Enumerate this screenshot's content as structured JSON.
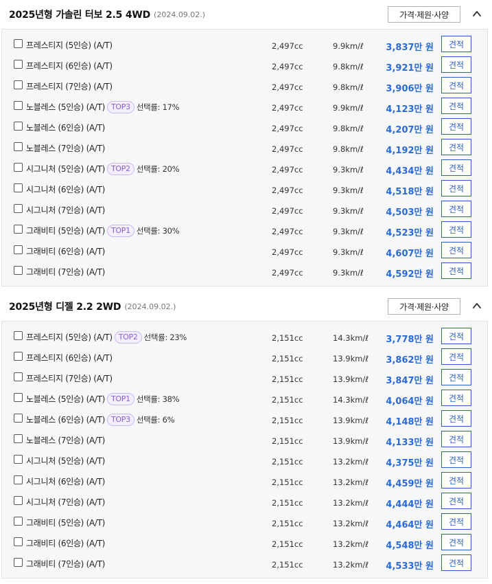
{
  "sections": [
    {
      "title": "2025년형 가솔린 터보 2.5 4WD",
      "date": "(2024.09.02.)",
      "spec_button_label": "가격·제원·사양",
      "collapse_icon": "chevron-up-icon",
      "trims": [
        {
          "name": "프레스티지 (5인승) (A/T)",
          "badge": "",
          "rate": "",
          "cc": "2,497cc",
          "fuel": "9.9km/ℓ",
          "price_value": "3,837",
          "price_unit": "만 원",
          "estimate_label": "견적"
        },
        {
          "name": "프레스티지 (6인승) (A/T)",
          "badge": "",
          "rate": "",
          "cc": "2,497cc",
          "fuel": "9.8km/ℓ",
          "price_value": "3,921",
          "price_unit": "만 원",
          "estimate_label": "견적"
        },
        {
          "name": "프레스티지 (7인승) (A/T)",
          "badge": "",
          "rate": "",
          "cc": "2,497cc",
          "fuel": "9.8km/ℓ",
          "price_value": "3,906",
          "price_unit": "만 원",
          "estimate_label": "견적"
        },
        {
          "name": "노블레스 (5인승) (A/T)",
          "badge": "TOP3",
          "rate": "선택률: 17%",
          "cc": "2,497cc",
          "fuel": "9.9km/ℓ",
          "price_value": "4,123",
          "price_unit": "만 원",
          "estimate_label": "견적"
        },
        {
          "name": "노블레스 (6인승) (A/T)",
          "badge": "",
          "rate": "",
          "cc": "2,497cc",
          "fuel": "9.8km/ℓ",
          "price_value": "4,207",
          "price_unit": "만 원",
          "estimate_label": "견적"
        },
        {
          "name": "노블레스 (7인승) (A/T)",
          "badge": "",
          "rate": "",
          "cc": "2,497cc",
          "fuel": "9.8km/ℓ",
          "price_value": "4,192",
          "price_unit": "만 원",
          "estimate_label": "견적"
        },
        {
          "name": "시그니처 (5인승) (A/T)",
          "badge": "TOP2",
          "rate": "선택률: 20%",
          "cc": "2,497cc",
          "fuel": "9.3km/ℓ",
          "price_value": "4,434",
          "price_unit": "만 원",
          "estimate_label": "견적"
        },
        {
          "name": "시그니처 (6인승) (A/T)",
          "badge": "",
          "rate": "",
          "cc": "2,497cc",
          "fuel": "9.3km/ℓ",
          "price_value": "4,518",
          "price_unit": "만 원",
          "estimate_label": "견적"
        },
        {
          "name": "시그니처 (7인승) (A/T)",
          "badge": "",
          "rate": "",
          "cc": "2,497cc",
          "fuel": "9.3km/ℓ",
          "price_value": "4,503",
          "price_unit": "만 원",
          "estimate_label": "견적"
        },
        {
          "name": "그래비티 (5인승) (A/T)",
          "badge": "TOP1",
          "rate": "선택률: 30%",
          "cc": "2,497cc",
          "fuel": "9.3km/ℓ",
          "price_value": "4,523",
          "price_unit": "만 원",
          "estimate_label": "견적"
        },
        {
          "name": "그래비티 (6인승) (A/T)",
          "badge": "",
          "rate": "",
          "cc": "2,497cc",
          "fuel": "9.3km/ℓ",
          "price_value": "4,607",
          "price_unit": "만 원",
          "estimate_label": "견적"
        },
        {
          "name": "그래비티 (7인승) (A/T)",
          "badge": "",
          "rate": "",
          "cc": "2,497cc",
          "fuel": "9.3km/ℓ",
          "price_value": "4,592",
          "price_unit": "만 원",
          "estimate_label": "견적"
        }
      ]
    },
    {
      "title": "2025년형 디젤 2.2 2WD",
      "date": "(2024.09.02.)",
      "spec_button_label": "가격·제원·사양",
      "collapse_icon": "chevron-up-icon",
      "trims": [
        {
          "name": "프레스티지 (5인승) (A/T)",
          "badge": "TOP2",
          "rate": "선택률: 23%",
          "cc": "2,151cc",
          "fuel": "14.3km/ℓ",
          "price_value": "3,778",
          "price_unit": "만 원",
          "estimate_label": "견적"
        },
        {
          "name": "프레스티지 (6인승) (A/T)",
          "badge": "",
          "rate": "",
          "cc": "2,151cc",
          "fuel": "13.9km/ℓ",
          "price_value": "3,862",
          "price_unit": "만 원",
          "estimate_label": "견적"
        },
        {
          "name": "프레스티지 (7인승) (A/T)",
          "badge": "",
          "rate": "",
          "cc": "2,151cc",
          "fuel": "13.9km/ℓ",
          "price_value": "3,847",
          "price_unit": "만 원",
          "estimate_label": "견적"
        },
        {
          "name": "노블레스 (5인승) (A/T)",
          "badge": "TOP1",
          "rate": "선택률: 38%",
          "cc": "2,151cc",
          "fuel": "14.3km/ℓ",
          "price_value": "4,064",
          "price_unit": "만 원",
          "estimate_label": "견적"
        },
        {
          "name": "노블레스 (6인승) (A/T)",
          "badge": "TOP3",
          "rate": "선택률: 6%",
          "cc": "2,151cc",
          "fuel": "13.9km/ℓ",
          "price_value": "4,148",
          "price_unit": "만 원",
          "estimate_label": "견적"
        },
        {
          "name": "노블레스 (7인승) (A/T)",
          "badge": "",
          "rate": "",
          "cc": "2,151cc",
          "fuel": "13.9km/ℓ",
          "price_value": "4,133",
          "price_unit": "만 원",
          "estimate_label": "견적"
        },
        {
          "name": "시그니처 (5인승) (A/T)",
          "badge": "",
          "rate": "",
          "cc": "2,151cc",
          "fuel": "13.2km/ℓ",
          "price_value": "4,375",
          "price_unit": "만 원",
          "estimate_label": "견적"
        },
        {
          "name": "시그니처 (6인승) (A/T)",
          "badge": "",
          "rate": "",
          "cc": "2,151cc",
          "fuel": "13.2km/ℓ",
          "price_value": "4,459",
          "price_unit": "만 원",
          "estimate_label": "견적"
        },
        {
          "name": "시그니처 (7인승) (A/T)",
          "badge": "",
          "rate": "",
          "cc": "2,151cc",
          "fuel": "13.2km/ℓ",
          "price_value": "4,444",
          "price_unit": "만 원",
          "estimate_label": "견적"
        },
        {
          "name": "그래비티 (5인승) (A/T)",
          "badge": "",
          "rate": "",
          "cc": "2,151cc",
          "fuel": "13.2km/ℓ",
          "price_value": "4,464",
          "price_unit": "만 원",
          "estimate_label": "견적"
        },
        {
          "name": "그래비티 (6인승) (A/T)",
          "badge": "",
          "rate": "",
          "cc": "2,151cc",
          "fuel": "13.2km/ℓ",
          "price_value": "4,548",
          "price_unit": "만 원",
          "estimate_label": "견적"
        },
        {
          "name": "그래비티 (7인승) (A/T)",
          "badge": "",
          "rate": "",
          "cc": "2,151cc",
          "fuel": "13.2km/ℓ",
          "price_value": "4,533",
          "price_unit": "만 원",
          "estimate_label": "견적"
        }
      ]
    }
  ],
  "colors": {
    "price": "#2a6ad8",
    "estimate_button": "#2d5ec9",
    "badge_text": "#8a5cd6",
    "badge_bg": "#f4efff",
    "list_bg": "#f6f7f9"
  }
}
